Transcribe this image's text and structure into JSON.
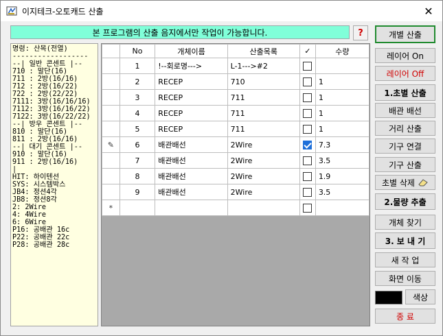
{
  "window": {
    "title": "이지테크-오토캐드 산출"
  },
  "notice": "본 프로그램의 산출 음지에서만 작업이 가능합니다.",
  "help_label": "?",
  "legend_lines": [
    "명령: 산목(전열)",
    "------------------",
    "--| 일반 콘센트 |--",
    "710 : 말단(16)",
    "711 : 2방(16/16)",
    "712 : 2방(16/22)",
    "722 : 2방(22/22)",
    "7111: 3방(16/16/16)",
    "7112: 3방(16/16/22)",
    "7122: 3방(16/22/22)",
    "",
    "--| 방우 콘센트 |--",
    "810 : 말단(16)",
    "811 : 2방(16/16)",
    "",
    "--| 대기 콘센트 |--",
    "910 : 말단(16)",
    "911 : 2방(16/16)",
    "|",
    "HIT: 하이텐션",
    "SYS: 시스템박스",
    "",
    "JB4: 정션4각",
    "JB8: 정션8각",
    "",
    "2: 2Wire",
    "4: 4Wire",
    "6: 6Wire",
    "",
    "P16: 공배관 16c",
    "P22: 공배관 22c",
    "P28: 공배관 28c"
  ],
  "grid": {
    "columns": [
      "",
      "No",
      "개체이름",
      "산출목록",
      "✓",
      "수량"
    ],
    "rows": [
      {
        "sel": "",
        "no": "1",
        "name": "!--회로명--->",
        "list": "L-1--->#2",
        "checked": false,
        "qty": ""
      },
      {
        "sel": "",
        "no": "2",
        "name": "RECEP",
        "list": "710",
        "checked": false,
        "qty": "1"
      },
      {
        "sel": "",
        "no": "3",
        "name": "RECEP",
        "list": "711",
        "checked": false,
        "qty": "1"
      },
      {
        "sel": "",
        "no": "4",
        "name": "RECEP",
        "list": "711",
        "checked": false,
        "qty": "1"
      },
      {
        "sel": "",
        "no": "5",
        "name": "RECEP",
        "list": "711",
        "checked": false,
        "qty": "1"
      },
      {
        "sel": "✎",
        "no": "6",
        "name": "배관배선",
        "list": "2Wire",
        "checked": true,
        "qty": "7.3"
      },
      {
        "sel": "",
        "no": "7",
        "name": "배관배선",
        "list": "2Wire",
        "checked": false,
        "qty": "3.5"
      },
      {
        "sel": "",
        "no": "8",
        "name": "배관배선",
        "list": "2Wire",
        "checked": false,
        "qty": "1.9"
      },
      {
        "sel": "",
        "no": "9",
        "name": "배관배선",
        "list": "2Wire",
        "checked": false,
        "qty": "3.5"
      },
      {
        "sel": "*",
        "no": "",
        "name": "",
        "list": "",
        "checked": false,
        "qty": ""
      }
    ]
  },
  "buttons": {
    "individual": "개별 산출",
    "layer_on": "레이어 On",
    "layer_off": "레이어 Off",
    "detail_calc": "1.초별 산출",
    "wiring": "배관 배선",
    "distance": "거리 산출",
    "device_link": "기구 연결",
    "device_calc": "기구 산출",
    "detail_delete": "초별 삭제",
    "quantity_extract": "2.물량 추출",
    "find_object": "개체 찾기",
    "export": "3. 보 내 기",
    "new_job": "새 작 업",
    "move_screen": "화면 이동",
    "color": "색상",
    "exit": "종 료"
  },
  "colors": {
    "notice_bg": "#80ffd9",
    "swatch": "#000000",
    "accent_green": "#1f8a2e"
  }
}
